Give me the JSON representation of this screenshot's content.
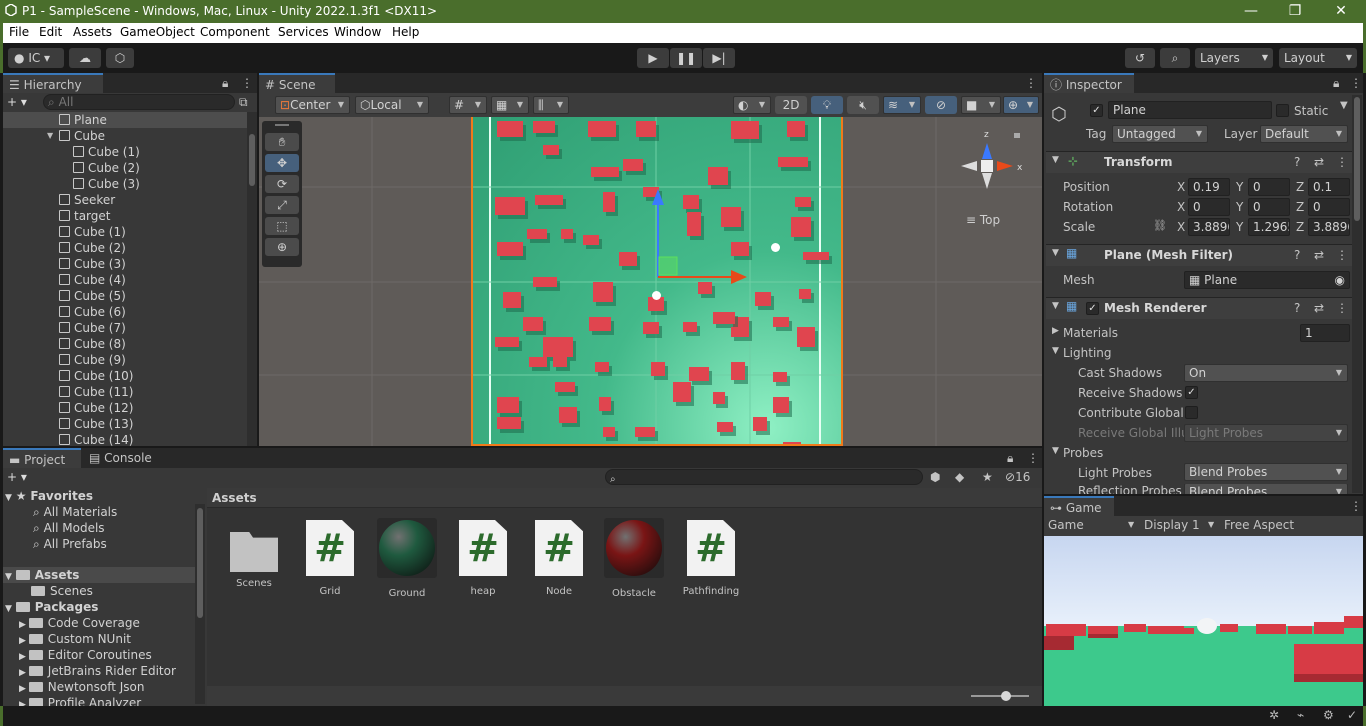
{
  "window": {
    "title": "P1 - SampleScene - Windows, Mac, Linux - Unity 2022.1.3f1 <DX11>",
    "minimize": "—",
    "maximize": "❐",
    "close": "✕"
  },
  "menu": [
    "File",
    "Edit",
    "Assets",
    "GameObject",
    "Component",
    "Services",
    "Window",
    "Help"
  ],
  "toolbar": {
    "account": "IC",
    "layers": "Layers",
    "layout": "Layout"
  },
  "hierarchy": {
    "tab": "Hierarchy",
    "search_placeholder": "All",
    "items": [
      {
        "label": "Plane",
        "indent": 1,
        "selected": true
      },
      {
        "label": "Cube",
        "indent": 1,
        "expanded": true
      },
      {
        "label": "Cube (1)",
        "indent": 2
      },
      {
        "label": "Cube (2)",
        "indent": 2
      },
      {
        "label": "Cube (3)",
        "indent": 2
      },
      {
        "label": "Seeker",
        "indent": 1
      },
      {
        "label": "target",
        "indent": 1
      },
      {
        "label": "Cube (1)",
        "indent": 1
      },
      {
        "label": "Cube (2)",
        "indent": 1
      },
      {
        "label": "Cube (3)",
        "indent": 1
      },
      {
        "label": "Cube (4)",
        "indent": 1
      },
      {
        "label": "Cube (5)",
        "indent": 1
      },
      {
        "label": "Cube (6)",
        "indent": 1
      },
      {
        "label": "Cube (7)",
        "indent": 1
      },
      {
        "label": "Cube (8)",
        "indent": 1
      },
      {
        "label": "Cube (9)",
        "indent": 1
      },
      {
        "label": "Cube (10)",
        "indent": 1
      },
      {
        "label": "Cube (11)",
        "indent": 1
      },
      {
        "label": "Cube (12)",
        "indent": 1
      },
      {
        "label": "Cube (13)",
        "indent": 1
      },
      {
        "label": "Cube (14)",
        "indent": 1
      }
    ]
  },
  "scene": {
    "tab": "Scene",
    "pivot": "Center",
    "space": "Local",
    "mode2d": "2D",
    "gizmo_view": "Top",
    "axis_x": "x",
    "axis_z": "z"
  },
  "inspector": {
    "tab": "Inspector",
    "object_name": "Plane",
    "static_label": "Static",
    "tag_label": "Tag",
    "tag_value": "Untagged",
    "layer_label": "Layer",
    "layer_value": "Default",
    "transform": {
      "title": "Transform",
      "position_label": "Position",
      "rotation_label": "Rotation",
      "scale_label": "Scale",
      "position": {
        "x": "0.19",
        "y": "0",
        "z": "0.1"
      },
      "rotation": {
        "x": "0",
        "y": "0",
        "z": "0"
      },
      "scale": {
        "x": "3.8896",
        "y": "1.2965",
        "z": "3.8896"
      }
    },
    "mesh_filter": {
      "title": "Plane (Mesh Filter)",
      "mesh_label": "Mesh",
      "mesh_value": "Plane"
    },
    "mesh_renderer": {
      "title": "Mesh Renderer",
      "materials_label": "Materials",
      "materials_count": "1",
      "lighting_label": "Lighting",
      "cast_shadows_label": "Cast Shadows",
      "cast_shadows_value": "On",
      "receive_shadows_label": "Receive Shadows",
      "contribute_gi_label": "Contribute Global I",
      "receive_gi_label": "Receive Global Illu",
      "receive_gi_value": "Light Probes",
      "probes_label": "Probes",
      "light_probes_label": "Light Probes",
      "light_probes_value": "Blend Probes",
      "reflection_probes_label": "Reflection Probes",
      "reflection_probes_value": "Blend Probes"
    }
  },
  "project": {
    "tab_project": "Project",
    "tab_console": "Console",
    "hidden_count": "16",
    "breadcrumb": "Assets",
    "favorites_label": "Favorites",
    "favorites": [
      "All Materials",
      "All Models",
      "All Prefabs"
    ],
    "assets_label": "Assets",
    "assets_children": [
      "Scenes"
    ],
    "packages_label": "Packages",
    "packages": [
      "Code Coverage",
      "Custom NUnit",
      "Editor Coroutines",
      "JetBrains Rider Editor",
      "Newtonsoft Json",
      "Profile Analyzer"
    ],
    "files": [
      {
        "name": "Scenes",
        "kind": "folder"
      },
      {
        "name": "Grid",
        "kind": "script"
      },
      {
        "name": "Ground",
        "kind": "material",
        "color": "#1f5a3f"
      },
      {
        "name": "heap",
        "kind": "script"
      },
      {
        "name": "Node",
        "kind": "script"
      },
      {
        "name": "Obstacle",
        "kind": "material",
        "color": "#7a1515"
      },
      {
        "name": "Pathfinding",
        "kind": "script"
      }
    ]
  },
  "game": {
    "tab": "Game",
    "mode": "Game",
    "display": "Display 1",
    "aspect": "Free Aspect"
  },
  "colors": {
    "title_bar": "#4a6e2c",
    "selection": "#2c5d87",
    "plane_green": "#3aa87e",
    "obstacle_red": "#e0454f",
    "accent_blue": "#3a79bb"
  }
}
